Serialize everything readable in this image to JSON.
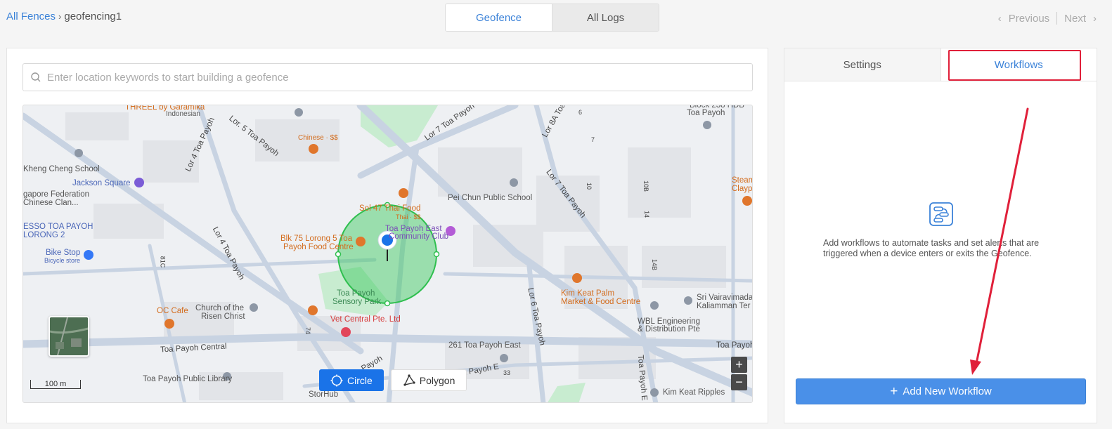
{
  "breadcrumb": {
    "root": "All Fences",
    "current": "geofencing1"
  },
  "top_tabs": [
    {
      "label": "Geofence"
    },
    {
      "label": "All Logs"
    }
  ],
  "pager": {
    "previous": "Previous",
    "next": "Next"
  },
  "search": {
    "placeholder": "Enter location keywords to start building a geofence"
  },
  "map": {
    "labels": {
      "threel": "THREEL by Garamika",
      "indonesian": "Indonesian",
      "chinese": "Chinese · $$",
      "kheng_cheng": "Kheng Cheng School",
      "jackson": "Jackson Square",
      "singapore_fed": "gapore Federation",
      "chinese_clan": "Chinese Clan...",
      "esso": "ESSO TOA PAYOH",
      "lorong2": "LORONG 2",
      "bike_stop": "Bike Stop",
      "bicycle_store": "Bicycle store",
      "oc_cafe": "OC Cafe",
      "church": "Church of the",
      "risen_christ": "Risen Christ",
      "toa_payoh_central": "Toa Payoh Central",
      "public_library": "Toa Payoh Public Library",
      "storhub": "StorHub",
      "sol47": "Sol 47 Thai Food",
      "thai": "Thai · $$",
      "blk75_1": "Blk 75 Lorong 5 Toa",
      "blk75_2": "Payoh Food Centre",
      "tp_east_1": "Toa Payoh East",
      "tp_east_2": "Community Club",
      "sensory_1": "Toa Payoh",
      "sensory_2": "Sensory Park",
      "vet": "Vet Central Pte. Ltd",
      "pei_chun": "Pei Chun Public School",
      "kim_keat_1": "Kim Keat Palm",
      "kim_keat_2": "Market & Food Centre",
      "tp_east_261": "261 Toa Payoh East",
      "wbl_1": "WBL Engineering",
      "wbl_2": "& Distribution Pte",
      "sri_1": "Sri Vairavimada",
      "sri_2": "Kaliamman Ter",
      "block_238_1": "Block 238 HDB",
      "block_238_2": "Toa Payoh",
      "steam_1": "Steam",
      "steam_2": "Claypo",
      "kim_keat_ripples": "Kim Keat Ripples",
      "toa_payoh_right": "Toa Payoh"
    },
    "roads": {
      "lor5": "Lor. 5 Toa Payoh",
      "lor4a": "Lor 4 Toa Payoh",
      "lor4b": "Lor 4 Toa Payoh",
      "lor7a": "Lor 7 Toa Payoh",
      "lor7b": "Lor 7 Toa Payoh",
      "lor8a": "Lor 8A Toa",
      "lor6": "Lor 6 Toa Payoh",
      "tp_e": "Toa Payoh E",
      "tp_lower": "Payoh",
      "tp_vert": "Toa Payoh E",
      "blk_6": "6",
      "blk_7": "7",
      "blk_10": "10",
      "blk_10b": "10B",
      "blk_14": "14",
      "blk_14b": "14B",
      "blk_81c": "81C",
      "blk_74": "74",
      "blk_33": "33"
    },
    "scale": "100 m",
    "modes": [
      {
        "label": "Circle"
      },
      {
        "label": "Polygon"
      }
    ],
    "zoom_in": "+",
    "zoom_out": "−"
  },
  "right_tabs": [
    {
      "label": "Settings"
    },
    {
      "label": "Workflows"
    }
  ],
  "workflows": {
    "empty_text": "Add workflows to automate tasks and set alerts that are triggered when a device enters or exits the Geofence.",
    "add_button": "Add New Workflow"
  },
  "colors": {
    "accent": "#3b82d8",
    "button": "#4a90e8",
    "annotation": "#e0203a",
    "geofence": "#2fbf4f"
  }
}
